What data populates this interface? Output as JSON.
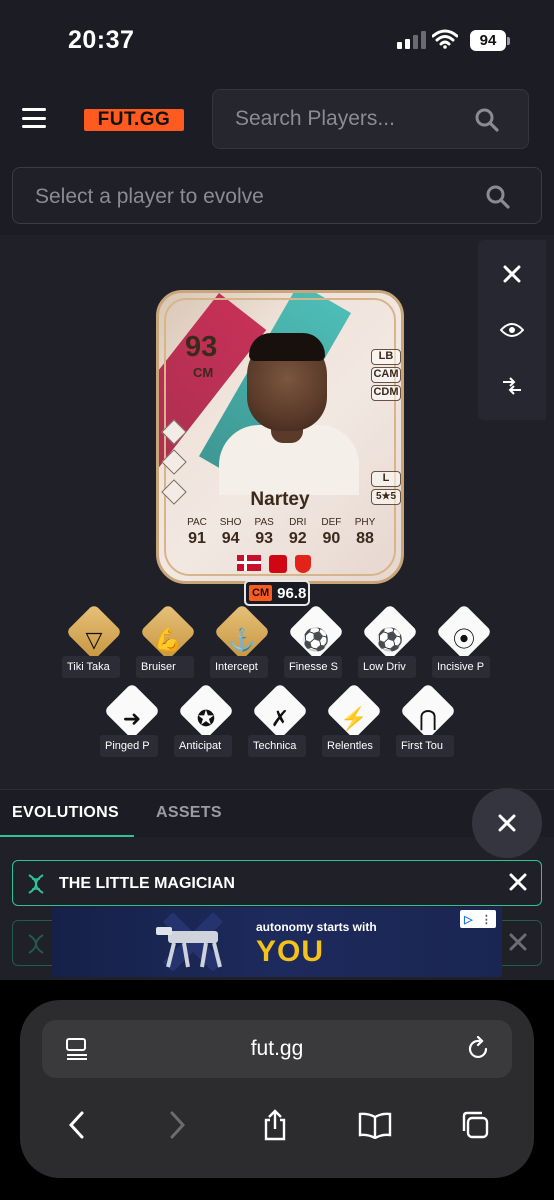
{
  "status_bar": {
    "time": "20:37",
    "battery": "94"
  },
  "header": {
    "logo": "FUT.GG",
    "search_placeholder": "Search Players...",
    "evolve_placeholder": "Select a player to evolve"
  },
  "card": {
    "rating": "93",
    "position": "CM",
    "alt_positions": [
      "LB",
      "CAM",
      "CDM"
    ],
    "foot": "L",
    "skills_weakfoot": "5★5",
    "name": "Nartey",
    "stats": [
      {
        "label": "PAC",
        "value": "91"
      },
      {
        "label": "SHO",
        "value": "94"
      },
      {
        "label": "PAS",
        "value": "93"
      },
      {
        "label": "DRI",
        "value": "92"
      },
      {
        "label": "DEF",
        "value": "90"
      },
      {
        "label": "PHY",
        "value": "88"
      }
    ],
    "score_position": "CM",
    "score_value": "96.8"
  },
  "playstyles_row1": [
    {
      "label": "Tiki Taka",
      "style": "gold",
      "icon": "tiki-taka-icon"
    },
    {
      "label": "Bruiser",
      "style": "gold",
      "icon": "bruiser-icon"
    },
    {
      "label": "Intercept",
      "style": "gold",
      "icon": "intercept-icon"
    },
    {
      "label": "Finesse S",
      "style": "white",
      "icon": "finesse-shot-icon"
    },
    {
      "label": "Low Driv",
      "style": "white",
      "icon": "low-driven-shot-icon"
    },
    {
      "label": "Incisive P",
      "style": "white",
      "icon": "incisive-pass-icon"
    }
  ],
  "playstyles_row2": [
    {
      "label": "Pinged P",
      "style": "white",
      "icon": "pinged-pass-icon"
    },
    {
      "label": "Anticipat",
      "style": "white",
      "icon": "anticipate-icon"
    },
    {
      "label": "Technica",
      "style": "white",
      "icon": "technical-icon"
    },
    {
      "label": "Relentles",
      "style": "white",
      "icon": "relentless-icon"
    },
    {
      "label": "First Tou",
      "style": "white",
      "icon": "first-touch-icon"
    }
  ],
  "tabs": {
    "evolutions": "EVOLUTIONS",
    "assets": "ASSETS"
  },
  "evolutions": [
    {
      "title": "THE LITTLE MAGICIAN"
    }
  ],
  "ad": {
    "line1": "autonomy starts with",
    "line2": "YOU"
  },
  "browser": {
    "url": "fut.gg"
  },
  "colors": {
    "accent": "#2ec29a",
    "brand": "#ff5a1f",
    "gold": "#d6ad5e"
  }
}
